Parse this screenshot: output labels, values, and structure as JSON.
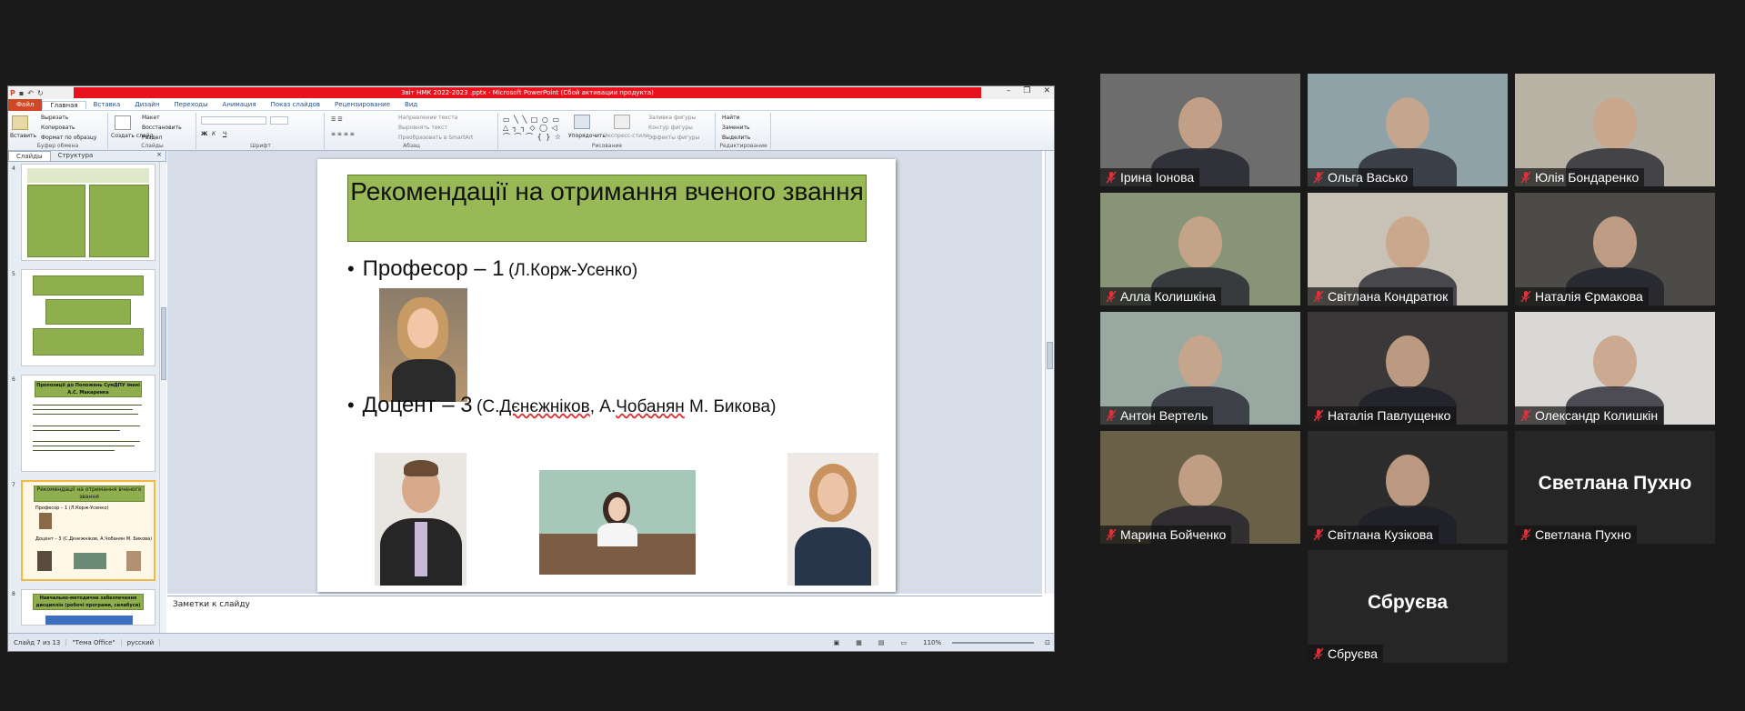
{
  "ppt": {
    "title": "Звіт НМК 2022-2023 .pptx - Microsoft PowerPoint (Сбой активации продукта)",
    "menu": [
      "Файл",
      "Главная",
      "Вставка",
      "Дизайн",
      "Переходы",
      "Анимация",
      "Показ слайдов",
      "Рецензирование",
      "Вид"
    ],
    "ribbon": {
      "paste": "Вставить",
      "cut": "Вырезать",
      "copy": "Копировать",
      "format": "Формат по образцу",
      "clipboard": "Буфер обмена",
      "new_slide": "Создать слайд",
      "layout": "Макет",
      "reset": "Восстановить",
      "section": "Раздел",
      "slides": "Слайды",
      "font": "Шрифт",
      "text_dir": "Направление текста",
      "align_text": "Выровнять текст",
      "smartart": "Преобразовать в SmartArt",
      "paragraph": "Абзац",
      "arrange": "Упорядочить",
      "quick_styles": "Экспресс-стили",
      "fill": "Заливка фигуры",
      "outline": "Контур фигуры",
      "effects": "Эффекты фигуры",
      "drawing": "Рисование",
      "find": "Найти",
      "replace": "Заменить",
      "select": "Выделить",
      "editing": "Редактирование"
    },
    "tabs": {
      "slides": "Слайды",
      "outline": "Структура",
      "close": "×"
    },
    "thumbs": {
      "n4": "4",
      "n5": "5",
      "n6": "6",
      "n7": "7",
      "n8": "8",
      "t6_title": "Пропозиції до Положень СумДПУ імені А.С. Макаренка",
      "t7_title": "Рекомендації на отримання вченого звання",
      "t7_b1": "Професор – 1 (Л.Корж-Усенко)",
      "t7_b2": "Доцент – 3 (С.Дєнєжніков, А.Чобанян М. Бикова)",
      "t8_title": "Навчально-методичне забезпечення дисциплін (робочі програми, силабуси)"
    },
    "slide": {
      "title": "Рекомендації на отримання вченого звання",
      "bullet1_main": "Професор – 1",
      "bullet1_small": "(Л.Корж-Усенко)",
      "bullet2_main": "Доцент – 3",
      "bullet2_small_a": "(С.",
      "bullet2_small_b": "Дєнєжніков",
      "bullet2_small_c": ", А.",
      "bullet2_small_d": "Чобанян",
      "bullet2_small_e": " М. Бикова)"
    },
    "notes": "Заметки к слайду",
    "status": {
      "slide": "Слайд 7 из 13",
      "theme": "\"Тема Office\"",
      "lang": "русский",
      "zoom": "110%"
    }
  },
  "participants": [
    {
      "name": "Ірина Іонова",
      "bg": "#6d6d6d"
    },
    {
      "name": "Ольга Васько",
      "bg": "#8fa2a8"
    },
    {
      "name": "Юлія Бондаренко",
      "bg": "#b9b3a6",
      "speaking": true
    },
    {
      "name": "Алла Колишкіна",
      "bg": "#879478"
    },
    {
      "name": "Світлана Кондратюк",
      "bg": "#c8c2b6"
    },
    {
      "name": "Наталія  Єрмакова",
      "bg": "#4d4b47"
    },
    {
      "name": "Антон Вертель",
      "bg": "#9aa8a2"
    },
    {
      "name": "Наталія Павлущенко",
      "bg": "#3a3838"
    },
    {
      "name": "Олександр Колишкін",
      "bg": "#d9d8d5"
    },
    {
      "name": "Марина Бойченко",
      "bg": "#6a6048"
    },
    {
      "name": "Світлана Кузікова",
      "bg": "#2c2c2c"
    },
    {
      "name": "Светлана Пухно",
      "bg": "#262626",
      "big": "Светлана Пухно"
    },
    {
      "name": "Сбруєва",
      "bg": "#262626",
      "big": "Сбруєва"
    }
  ],
  "colors": {
    "mic_muted": "#e0303a",
    "speaking_border": "#d6e86c",
    "slide_title_fill": "#98b955"
  }
}
